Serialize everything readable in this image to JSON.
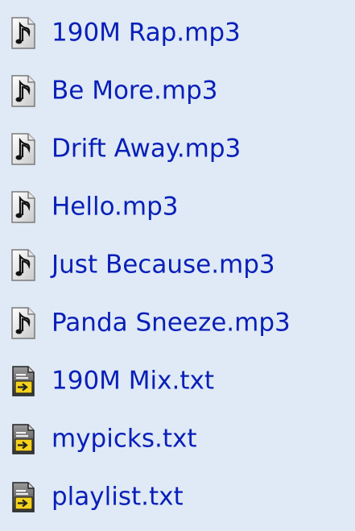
{
  "files": [
    {
      "name": "190M Rap.mp3",
      "icon": "audio-file-icon"
    },
    {
      "name": "Be More.mp3",
      "icon": "audio-file-icon"
    },
    {
      "name": "Drift Away.mp3",
      "icon": "audio-file-icon"
    },
    {
      "name": "Hello.mp3",
      "icon": "audio-file-icon"
    },
    {
      "name": "Just Because.mp3",
      "icon": "audio-file-icon"
    },
    {
      "name": "Panda Sneeze.mp3",
      "icon": "audio-file-icon"
    },
    {
      "name": "190M Mix.txt",
      "icon": "playlist-file-icon"
    },
    {
      "name": "mypicks.txt",
      "icon": "playlist-file-icon"
    },
    {
      "name": "playlist.txt",
      "icon": "playlist-file-icon"
    }
  ],
  "colors": {
    "background": "#dfeaf6",
    "link": "#0a1fb8"
  }
}
